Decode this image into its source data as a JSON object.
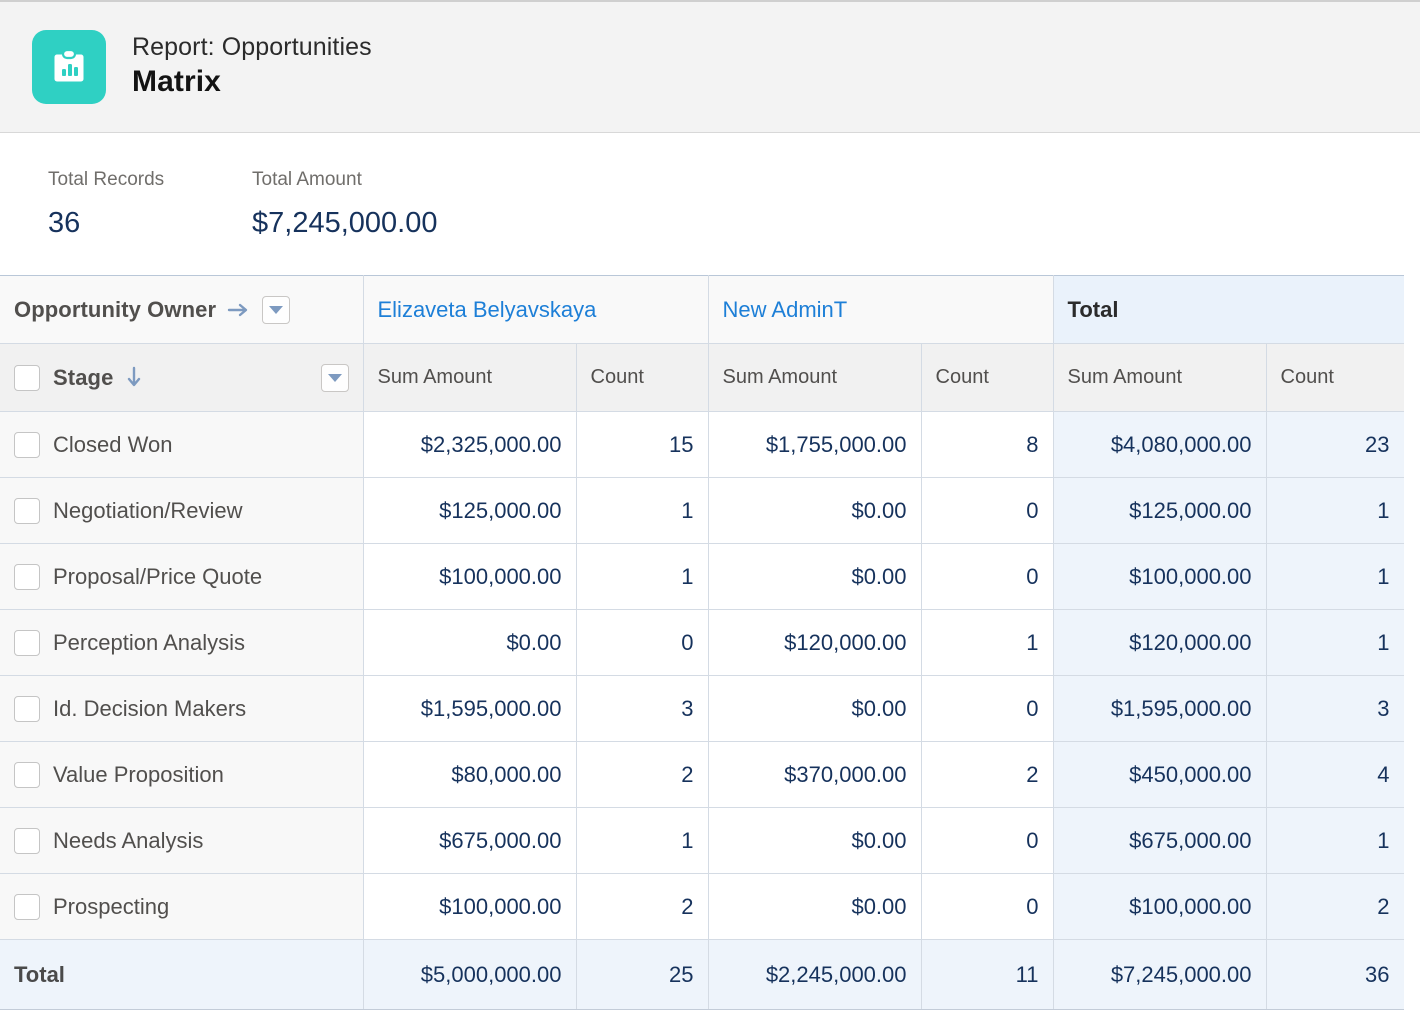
{
  "header": {
    "icon": "clipboard-chart-icon",
    "icon_color": "#2fd0c3",
    "kicker": "Report: Opportunities",
    "title": "Matrix"
  },
  "summary": {
    "records_label": "Total Records",
    "records_value": "36",
    "amount_label": "Total Amount",
    "amount_value": "$7,245,000.00",
    "value_color": "#16325c"
  },
  "table": {
    "row_group": {
      "header_label": "Opportunity Owner",
      "header_arrow": "arrow-right-icon",
      "stage_label": "Stage",
      "stage_sort": "sort-descending-arrow-icon",
      "dropdown_icon": "chevron-down-icon"
    },
    "column_groups": [
      {
        "name": "Elizaveta Belyavskaya",
        "is_total": false
      },
      {
        "name": "New AdminT",
        "is_total": false
      },
      {
        "name": "Total",
        "is_total": true
      }
    ],
    "measures": [
      "Sum Amount",
      "Count"
    ],
    "measure_headers": [
      "Sum Amount",
      "Count",
      "Sum Amount",
      "Count",
      "Sum Amount",
      "Count"
    ],
    "rows": [
      {
        "stage": "Closed Won",
        "cells": [
          "$2,325,000.00",
          "15",
          "$1,755,000.00",
          "8",
          "$4,080,000.00",
          "23"
        ]
      },
      {
        "stage": "Negotiation/Review",
        "cells": [
          "$125,000.00",
          "1",
          "$0.00",
          "0",
          "$125,000.00",
          "1"
        ]
      },
      {
        "stage": "Proposal/Price Quote",
        "cells": [
          "$100,000.00",
          "1",
          "$0.00",
          "0",
          "$100,000.00",
          "1"
        ]
      },
      {
        "stage": "Perception Analysis",
        "cells": [
          "$0.00",
          "0",
          "$120,000.00",
          "1",
          "$120,000.00",
          "1"
        ]
      },
      {
        "stage": "Id. Decision Makers",
        "cells": [
          "$1,595,000.00",
          "3",
          "$0.00",
          "0",
          "$1,595,000.00",
          "3"
        ]
      },
      {
        "stage": "Value Proposition",
        "cells": [
          "$80,000.00",
          "2",
          "$370,000.00",
          "2",
          "$450,000.00",
          "4"
        ]
      },
      {
        "stage": "Needs Analysis",
        "cells": [
          "$675,000.00",
          "1",
          "$0.00",
          "0",
          "$675,000.00",
          "1"
        ]
      },
      {
        "stage": "Prospecting",
        "cells": [
          "$100,000.00",
          "2",
          "$0.00",
          "0",
          "$100,000.00",
          "2"
        ]
      }
    ],
    "total_row": {
      "label": "Total",
      "cells": [
        "$5,000,000.00",
        "25",
        "$2,245,000.00",
        "11",
        "$7,245,000.00",
        "36"
      ]
    }
  },
  "chart_data": {
    "type": "table",
    "title": "Report: Opportunities — Matrix",
    "row_dimension": "Stage",
    "column_dimension": "Opportunity Owner",
    "measures": [
      "Sum Amount",
      "Count"
    ],
    "categories": [
      "Closed Won",
      "Negotiation/Review",
      "Proposal/Price Quote",
      "Perception Analysis",
      "Id. Decision Makers",
      "Value Proposition",
      "Needs Analysis",
      "Prospecting"
    ],
    "series": [
      {
        "name": "Elizaveta Belyavskaya — Sum Amount",
        "values": [
          2325000,
          125000,
          100000,
          0,
          1595000,
          80000,
          675000,
          100000
        ]
      },
      {
        "name": "Elizaveta Belyavskaya — Count",
        "values": [
          15,
          1,
          1,
          0,
          3,
          2,
          1,
          2
        ]
      },
      {
        "name": "New AdminT — Sum Amount",
        "values": [
          1755000,
          0,
          0,
          120000,
          0,
          370000,
          0,
          0
        ]
      },
      {
        "name": "New AdminT — Count",
        "values": [
          8,
          0,
          0,
          1,
          0,
          2,
          0,
          0
        ]
      },
      {
        "name": "Total — Sum Amount",
        "values": [
          4080000,
          125000,
          100000,
          120000,
          1595000,
          450000,
          675000,
          100000
        ]
      },
      {
        "name": "Total — Count",
        "values": [
          23,
          1,
          1,
          1,
          3,
          4,
          1,
          2
        ]
      }
    ],
    "column_totals": {
      "Elizaveta Belyavskaya — Sum Amount": 5000000,
      "Elizaveta Belyavskaya — Count": 25,
      "New AdminT — Sum Amount": 2245000,
      "New AdminT — Count": 11,
      "Total — Sum Amount": 7245000,
      "Total — Count": 36
    }
  }
}
